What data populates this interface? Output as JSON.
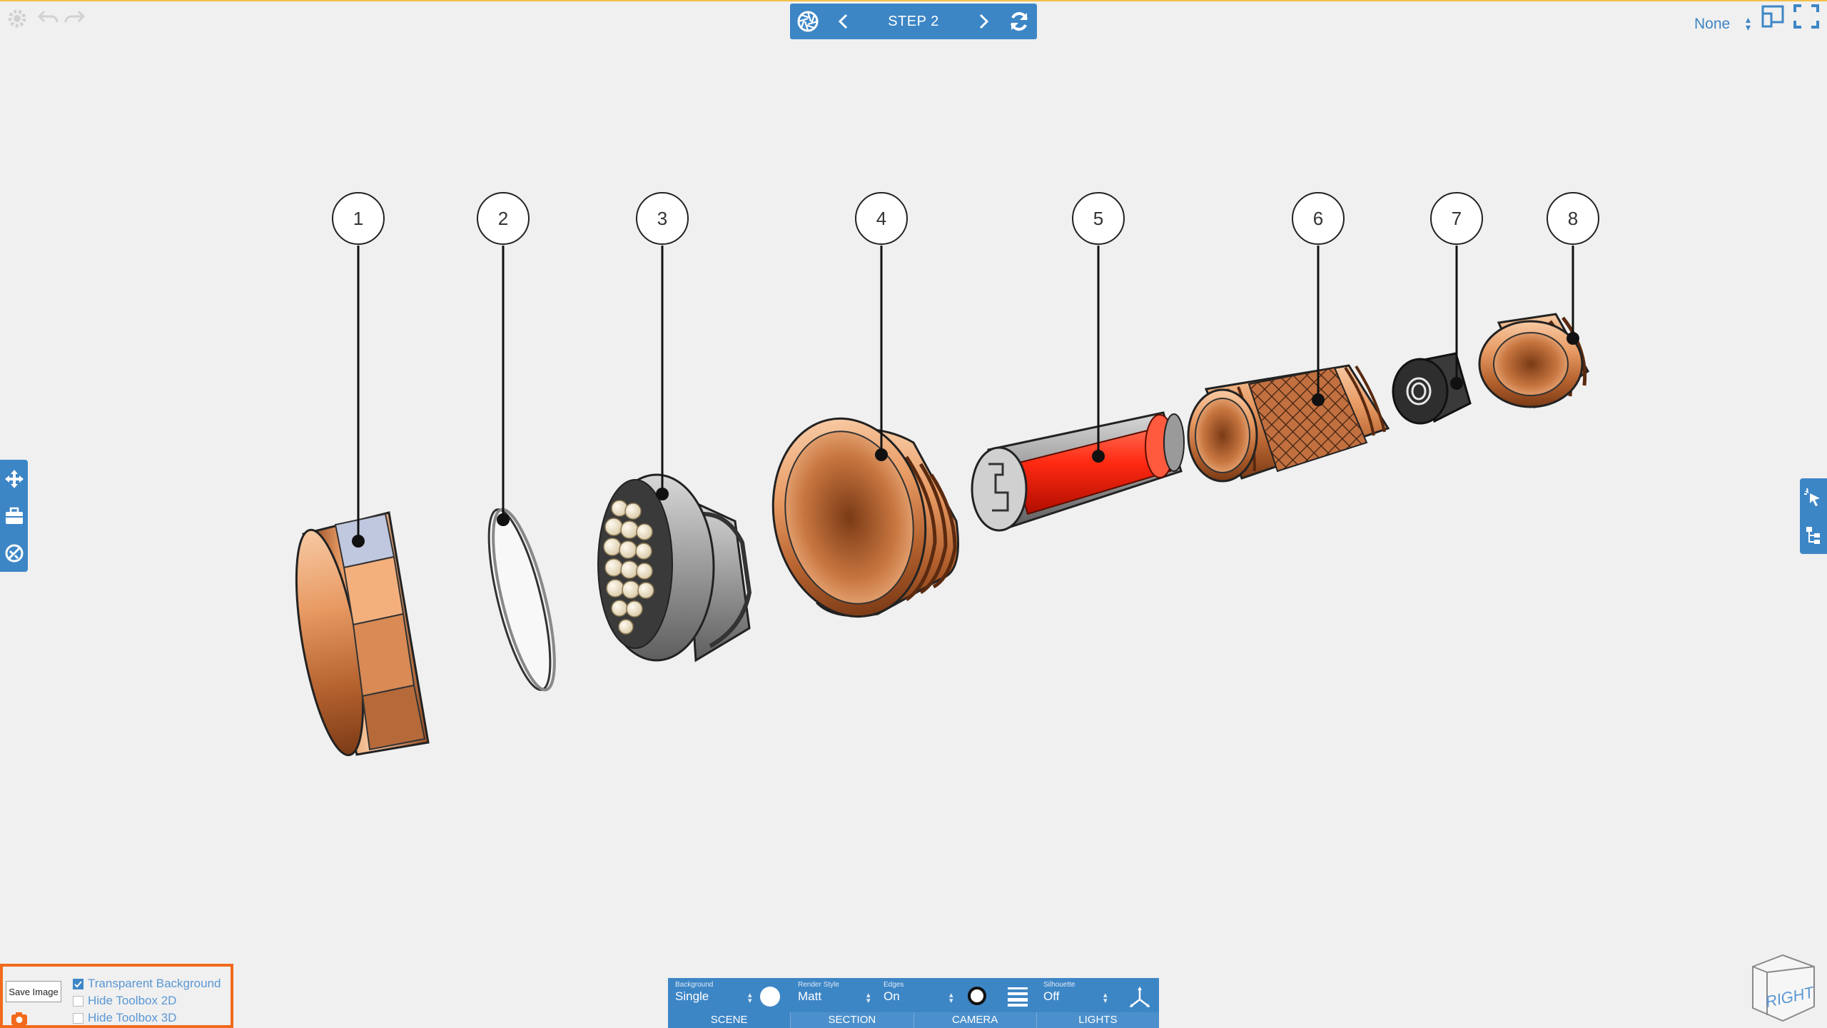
{
  "colors": {
    "accent": "#3d86c6",
    "highlight": "#f26a1b",
    "copper": "#c9794a",
    "battery": "#ff2a12"
  },
  "top_left": {
    "icons": [
      "gear-icon",
      "undo-icon",
      "redo-icon"
    ]
  },
  "step_nav": {
    "label": "STEP 2",
    "icons": [
      "aperture-icon",
      "chevron-left-icon",
      "chevron-right-icon",
      "refresh-icon"
    ]
  },
  "top_right": {
    "selector_value": "None",
    "icons": [
      "split-view-icon",
      "fullscreen-icon"
    ]
  },
  "left_toolbar": {
    "icons": [
      "move-icon",
      "toolbox-icon",
      "explode-icon"
    ]
  },
  "right_toolbar": {
    "icons": [
      "cursor-select-icon",
      "tree-structure-icon"
    ]
  },
  "callouts": [
    "1",
    "2",
    "3",
    "4",
    "5",
    "6",
    "7",
    "8"
  ],
  "save_panel": {
    "tooltip": "Save Image",
    "options": [
      {
        "label": "Transparent Background",
        "checked": true
      },
      {
        "label": "Hide Toolbox 2D",
        "checked": false
      },
      {
        "label": "Hide Toolbox 3D",
        "checked": false
      }
    ]
  },
  "bottom_toolbar": {
    "background": {
      "caption": "Background",
      "value": "Single"
    },
    "render_style": {
      "caption": "Render Style",
      "value": "Matt"
    },
    "edges": {
      "caption": "Edges",
      "value": "On"
    },
    "silhouette": {
      "caption": "Silhouette",
      "value": "Off"
    },
    "tabs": [
      "SCENE",
      "SECTION",
      "CAMERA",
      "LIGHTS"
    ],
    "active_tab": "SCENE"
  },
  "view_cube": {
    "face_label": "RIGHT"
  }
}
